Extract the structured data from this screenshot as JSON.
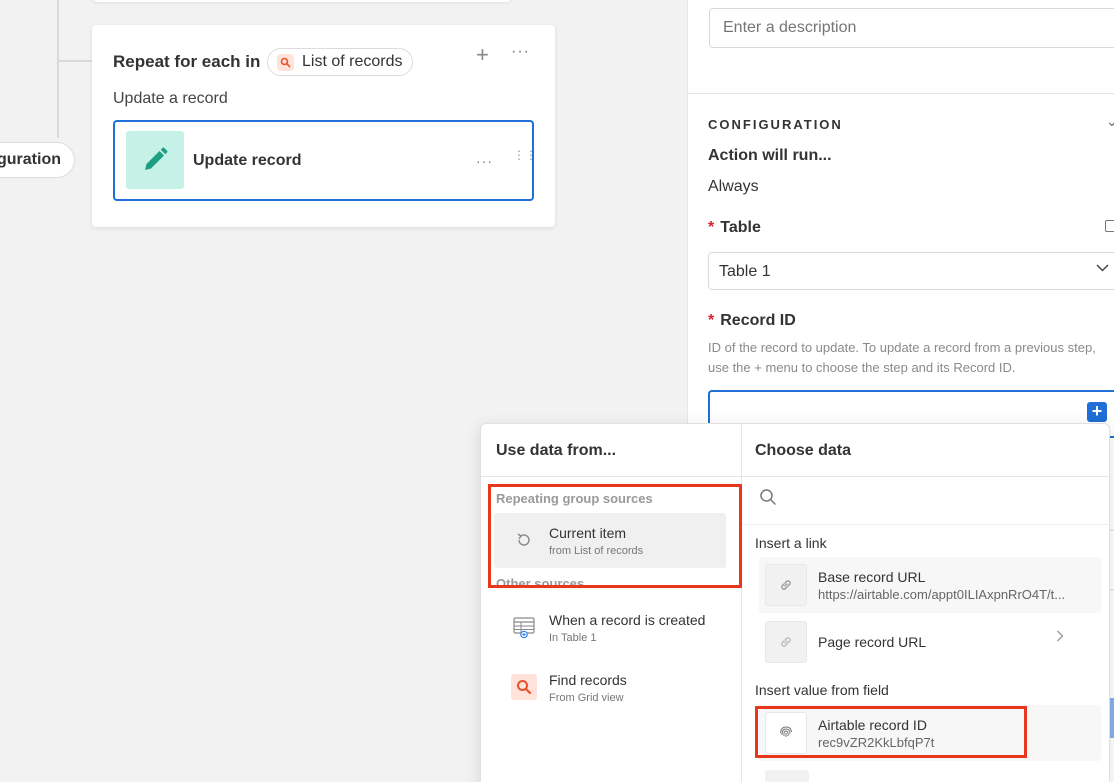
{
  "canvas": {
    "config_pill_label": "guration",
    "repeat_card": {
      "title": "Repeat for each in",
      "source_pill_label": "List of records",
      "add_icon": "plus-icon",
      "more_icon": "more-horizontal-icon",
      "subtitle": "Update a record",
      "action": {
        "label": "Update record",
        "icon": "pencil-icon",
        "icon_bg": "#c6f1e6",
        "icon_color": "#1e9e82"
      }
    }
  },
  "panel": {
    "description_placeholder": "Enter a description",
    "configuration_heading": "CONFIGURATION",
    "runs_label": "Action will run...",
    "runs_value": "Always",
    "table_label": "Table",
    "table_value": "Table 1",
    "record_id_label": "Record ID",
    "record_id_help": "ID of the record to update. To update a record from a previous step, use the + menu to choose the step and its Record ID.",
    "record_id_value": "",
    "required_marker": "*",
    "accent_color": "#1f6fd6"
  },
  "popover": {
    "left_title": "Use data from...",
    "right_title": "Choose data",
    "repeating_group_label": "Repeating group sources",
    "other_sources_label": "Other sources",
    "sources": [
      {
        "name": "Current item",
        "sub": "from List of records",
        "icon": "loop-icon",
        "selected": true
      },
      {
        "name": "When a record is created",
        "sub": "In Table 1",
        "icon": "table-icon",
        "selected": false
      },
      {
        "name": "Find records",
        "sub": "From Grid view",
        "icon": "search-icon",
        "selected": false
      }
    ],
    "search_placeholder": "",
    "insert_link_label": "Insert a link",
    "links": [
      {
        "name": "Base record URL",
        "value": "https://airtable.com/appt0ILIAxpnRrO4T/t...",
        "icon": "link-icon"
      },
      {
        "name": "Page record URL",
        "value": "",
        "icon": "link-icon"
      }
    ],
    "insert_field_label": "Insert value from field",
    "fields": [
      {
        "name": "Airtable record ID",
        "value": "rec9vZR2KkLbfqP7t",
        "icon": "fingerprint-icon"
      }
    ],
    "highlight_color": "#e8371c"
  }
}
